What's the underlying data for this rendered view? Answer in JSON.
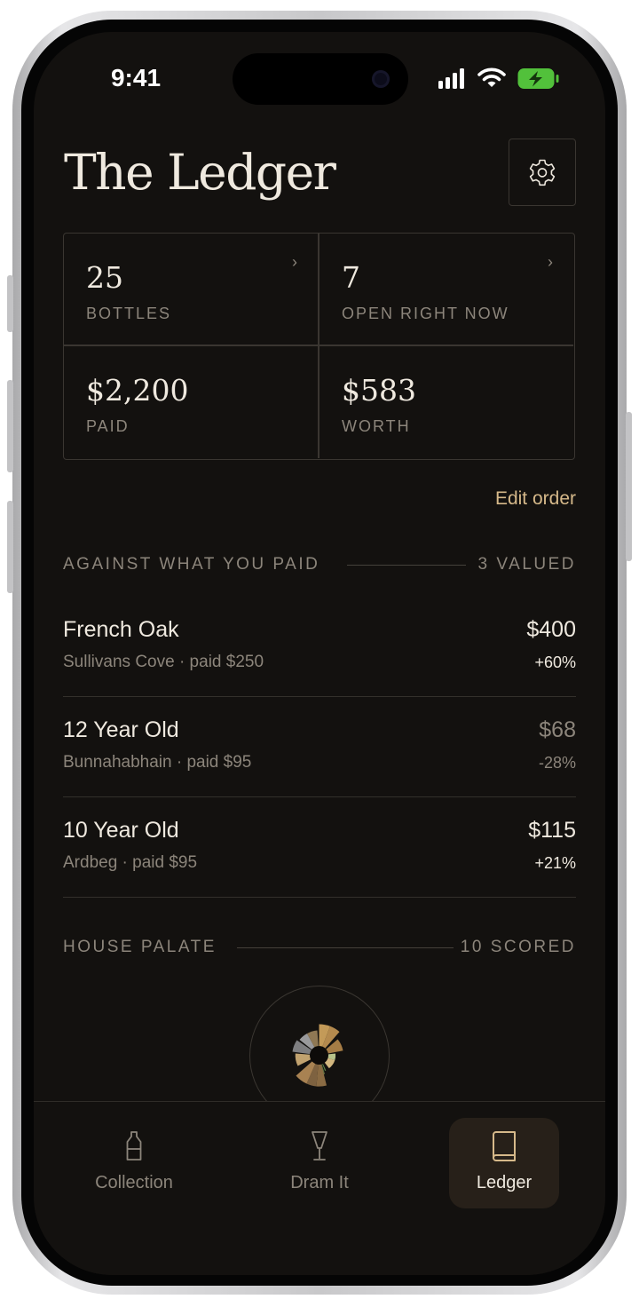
{
  "status": {
    "time": "9:41"
  },
  "header": {
    "title": "The Ledger",
    "settings_icon": "gear-icon"
  },
  "stats": [
    {
      "value": "25",
      "label": "BOTTLES",
      "has_chevron": true
    },
    {
      "value": "7",
      "label": "OPEN RIGHT NOW",
      "has_chevron": true
    },
    {
      "value": "$2,200",
      "label": "PAID",
      "has_chevron": false
    },
    {
      "value": "$583",
      "label": "WORTH",
      "has_chevron": false
    }
  ],
  "edit_order": "Edit order",
  "valued": {
    "title": "AGAINST WHAT YOU PAID",
    "count": "3 VALUED",
    "items": [
      {
        "name": "French Oak",
        "subtitle": "Sullivans Cove · paid $250",
        "value": "$400",
        "change": "+60%",
        "direction": "up"
      },
      {
        "name": "12 Year Old",
        "subtitle": "Bunnahabhain · paid $95",
        "value": "$68",
        "change": "-28%",
        "direction": "down"
      },
      {
        "name": "10 Year Old",
        "subtitle": "Ardbeg · paid $95",
        "value": "$115",
        "change": "+21%",
        "direction": "up"
      }
    ]
  },
  "palate": {
    "title": "HOUSE PALATE",
    "count": "10 SCORED"
  },
  "tabs": [
    {
      "label": "Collection",
      "icon": "bottle-icon",
      "active": false
    },
    {
      "label": "Dram It",
      "icon": "glass-icon",
      "active": false
    },
    {
      "label": "Ledger",
      "icon": "book-icon",
      "active": true
    }
  ],
  "colors": {
    "background": "#13110f",
    "text": "#efe9df",
    "muted": "#8c857b",
    "accent": "#d6b98a",
    "border": "#3a3631"
  }
}
